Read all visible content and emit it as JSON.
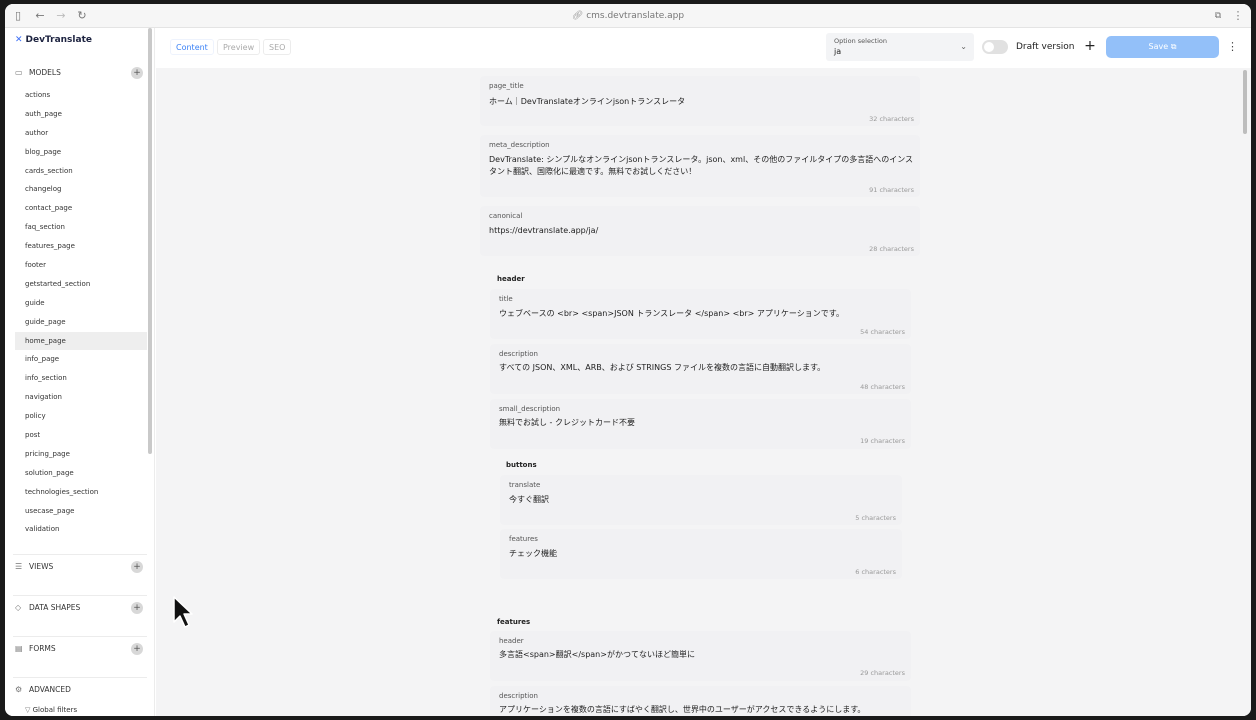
{
  "browser": {
    "url": "cms.devtranslate.app"
  },
  "sidebar": {
    "logo": "DevTranslate",
    "models_label": "MODELS",
    "models": [
      "actions",
      "auth_page",
      "author",
      "blog_page",
      "cards_section",
      "changelog",
      "contact_page",
      "faq_section",
      "features_page",
      "footer",
      "getstarted_section",
      "guide",
      "guide_page",
      "home_page",
      "info_page",
      "info_section",
      "navigation",
      "policy",
      "post",
      "pricing_page",
      "solution_page",
      "technologies_section",
      "usecase_page",
      "validation"
    ],
    "active_model": "home_page",
    "views_label": "VIEWS",
    "data_shapes_label": "DATA SHAPES",
    "forms_label": "FORMS",
    "advanced_label": "ADVANCED",
    "advanced_items": [
      "Global filters"
    ]
  },
  "toolbar": {
    "tabs": [
      "Content",
      "Preview",
      "SEO"
    ],
    "active_tab": "Content",
    "option_label": "Option selection",
    "option_value": "ja",
    "draft_label": "Draft version",
    "save_label": "Save"
  },
  "fields": {
    "page_title": {
      "label": "page_title",
      "value": "ホーム｜DevTranslateオンラインjsonトランスレータ",
      "count": "32 characters"
    },
    "meta_description": {
      "label": "meta_description",
      "value": "DevTranslate: シンプルなオンラインjsonトランスレータ。json、xml、その他のファイルタイプの多言語へのインスタント翻訳、国際化に最適です。無料でお試しください！",
      "count": "91 characters"
    },
    "canonical": {
      "label": "canonical",
      "value": "https://devtranslate.app/ja/",
      "count": "28 characters"
    },
    "header": {
      "label": "header",
      "title": {
        "label": "title",
        "value": "ウェブベースの <br> <span>JSON トランスレータ </span> <br> アプリケーションです。",
        "count": "54 characters"
      },
      "description": {
        "label": "description",
        "value": "すべての JSON、XML、ARB、および STRINGS ファイルを複数の言語に自動翻訳します。",
        "count": "48 characters"
      },
      "small_description": {
        "label": "small_description",
        "value": "無料でお試し - クレジットカード不要",
        "count": "19 characters"
      },
      "buttons": {
        "label": "buttons",
        "translate": {
          "label": "translate",
          "value": "今すぐ翻訳",
          "count": "5 characters"
        },
        "features": {
          "label": "features",
          "value": "チェック機能",
          "count": "6 characters"
        }
      }
    },
    "features": {
      "label": "features",
      "header": {
        "label": "header",
        "value": "多言語<span>翻訳</span>がかつてないほど簡単に",
        "count": "29 characters"
      },
      "description": {
        "label": "description",
        "value": "アプリケーションを複数の言語にすばやく翻訳し、世界中のユーザーがアクセスできるようにします。"
      }
    }
  }
}
